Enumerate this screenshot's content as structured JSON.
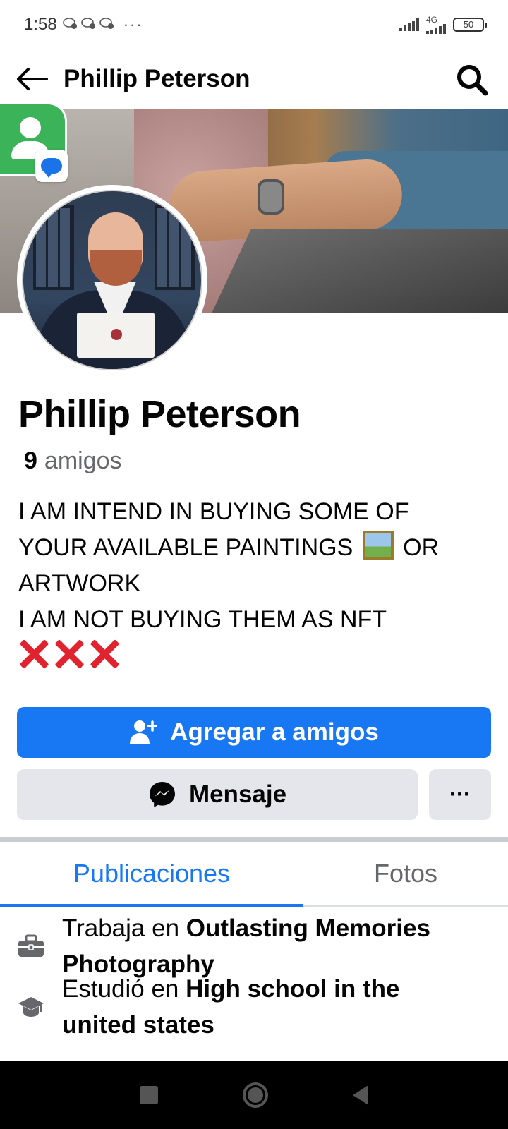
{
  "status_bar": {
    "time": "1:58",
    "network": "4G",
    "battery": "50"
  },
  "header": {
    "title": "Phillip Peterson"
  },
  "profile": {
    "name": "Phillip Peterson",
    "friends_count": "9",
    "friends_label": "amigos",
    "bio": {
      "line1": "I AM INTEND IN BUYING SOME OF",
      "line2a": "YOUR AVAILABLE PAINTINGS",
      "line2b": "OR",
      "line3": "ARTWORK",
      "line4": "I AM NOT BUYING THEM AS NFT"
    }
  },
  "actions": {
    "add_friend": "Agregar a amigos",
    "message": "Mensaje",
    "more": "···"
  },
  "tabs": [
    {
      "label": "Publicaciones",
      "active": true
    },
    {
      "label": "Fotos",
      "active": false
    }
  ],
  "about": {
    "work_prefix": "Trabaja en",
    "work_line1": "Outlasting Memories",
    "work_line2": "Photography",
    "edu_prefix": "Estudió en",
    "edu_line1": "High school in the",
    "edu_line2": "united states"
  },
  "colors": {
    "accent": "#1877f2",
    "secondary_button": "#e4e6eb",
    "muted_text": "#65676b"
  }
}
